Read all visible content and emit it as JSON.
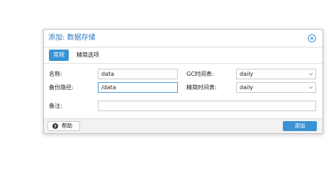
{
  "dialog": {
    "title": "添加: 数据存储",
    "close_icon": "close-circle-icon"
  },
  "tabs": [
    {
      "label": "常规",
      "active": true
    },
    {
      "label": "精简选项",
      "active": false
    }
  ],
  "form": {
    "name_label": "名称:",
    "name_value": "data",
    "path_label": "备份路径:",
    "path_value": "/data",
    "gc_label": "GC时间表:",
    "gc_value": "daily",
    "prune_label": "精简时间表:",
    "prune_value": "daily",
    "comment_label": "备注:",
    "comment_value": ""
  },
  "footer": {
    "help_label": "帮助",
    "help_icon": "question-circle-icon",
    "add_label": "添加"
  },
  "colors": {
    "accent": "#3892d4",
    "title": "#2f78c4",
    "focus_border": "#4a9ad6"
  }
}
